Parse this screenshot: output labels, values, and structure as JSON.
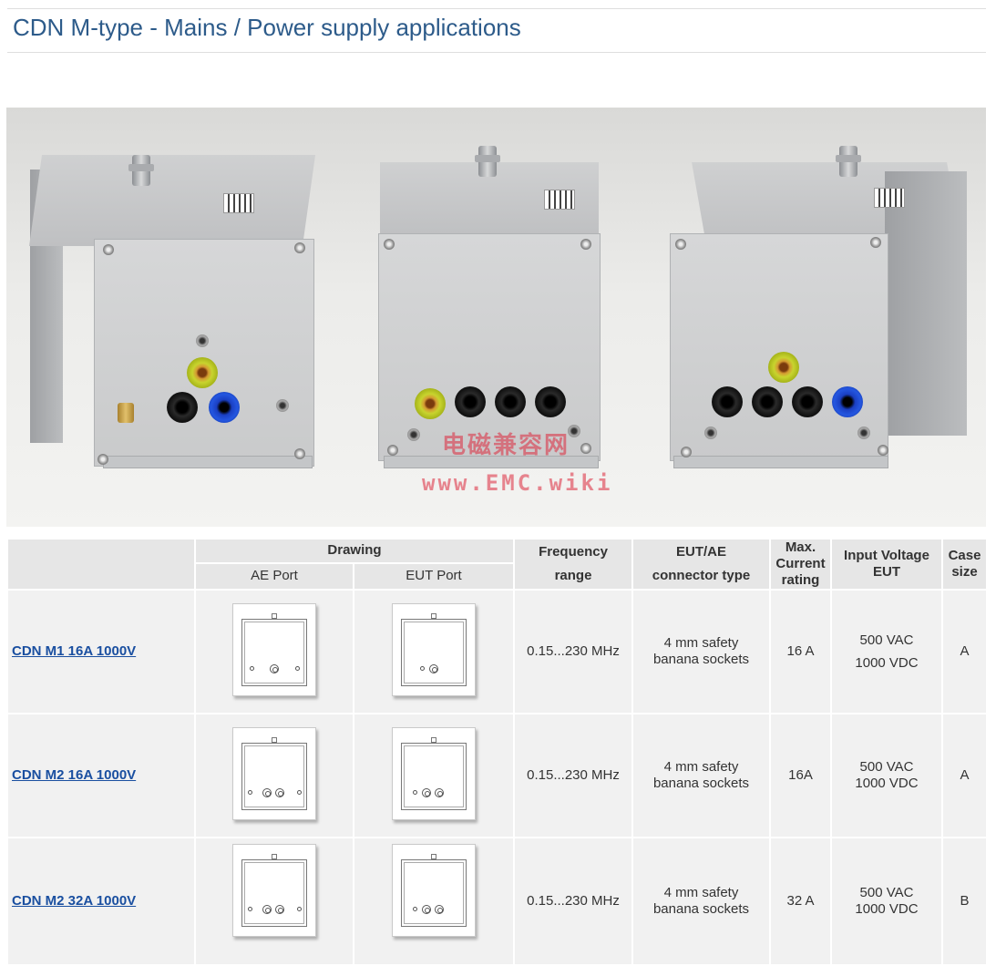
{
  "page": {
    "title": "CDN M-type - Mains / Power supply applications"
  },
  "watermark": {
    "cn": "电磁兼容网",
    "url": "www.EMC.wiki"
  },
  "table": {
    "headers": {
      "drawing": "Drawing",
      "ae_port": "AE Port",
      "eut_port": "EUT Port",
      "frequency": "Frequency range",
      "connector": "EUT/AE connector type",
      "current": "Max. Current rating",
      "voltage": "Input Voltage EUT",
      "case": "Case size"
    },
    "rows": [
      {
        "name": "CDN M1 16A 1000V",
        "frequency": "0.15...230 MHz",
        "connector": "4 mm safety\nbanana sockets",
        "current": "16 A",
        "voltage": "500 VAC\n1000 VDC",
        "case": "A"
      },
      {
        "name": "CDN M2 16A 1000V",
        "frequency": "0.15...230 MHz",
        "connector": "4 mm safety\nbanana sockets",
        "current": "16A",
        "voltage": "500 VAC\n1000 VDC",
        "case": "A"
      },
      {
        "name": "CDN M2 32A 1000V",
        "frequency": "0.15...230 MHz",
        "connector": "4 mm safety\nbanana sockets",
        "current": "32 A",
        "voltage": "500 VAC\n1000 VDC",
        "case": "B"
      }
    ]
  }
}
